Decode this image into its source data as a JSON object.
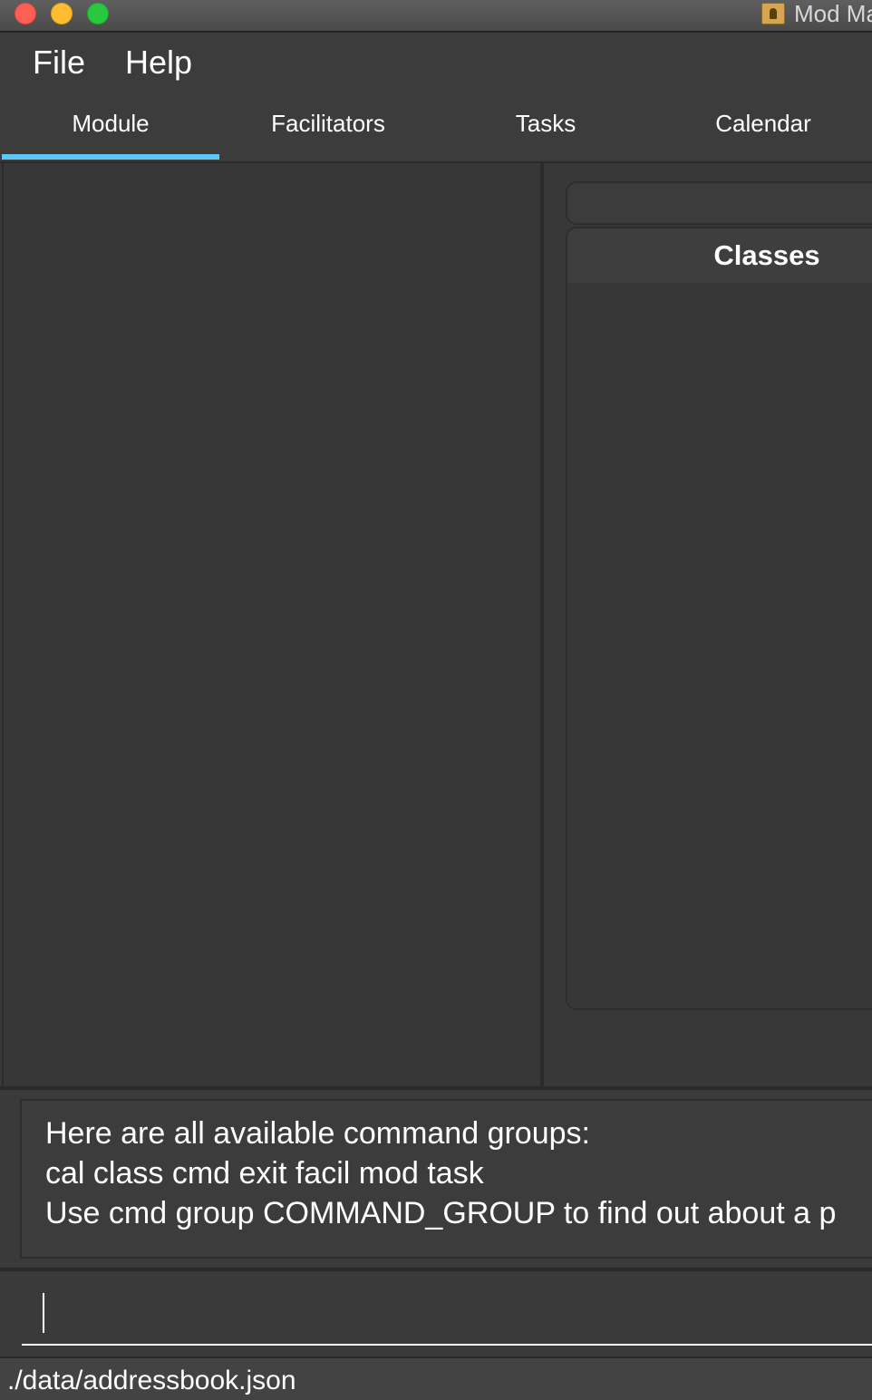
{
  "window": {
    "title": "Mod Ma",
    "buttons": [
      "close",
      "minimize",
      "zoom"
    ],
    "icon": "address-book-icon"
  },
  "menu": {
    "items": [
      {
        "label": "File"
      },
      {
        "label": "Help"
      }
    ]
  },
  "tabs": {
    "items": [
      {
        "label": "Module",
        "active": true
      },
      {
        "label": "Facilitators",
        "active": false
      },
      {
        "label": "Tasks",
        "active": false
      },
      {
        "label": "Calendar",
        "active": false
      }
    ],
    "active_color": "#5ec6f5"
  },
  "right_panel": {
    "classes_title": "Classes"
  },
  "result": {
    "lines": [
      "Here are all available command groups:",
      "cal class cmd exit facil mod task",
      "Use cmd group COMMAND_GROUP to find out about a p"
    ]
  },
  "command": {
    "value": "",
    "placeholder": ""
  },
  "status": {
    "path": "./data/addressbook.json"
  },
  "colors": {
    "background": "#383838",
    "accent": "#5ec6f5",
    "text": "#ffffff"
  }
}
